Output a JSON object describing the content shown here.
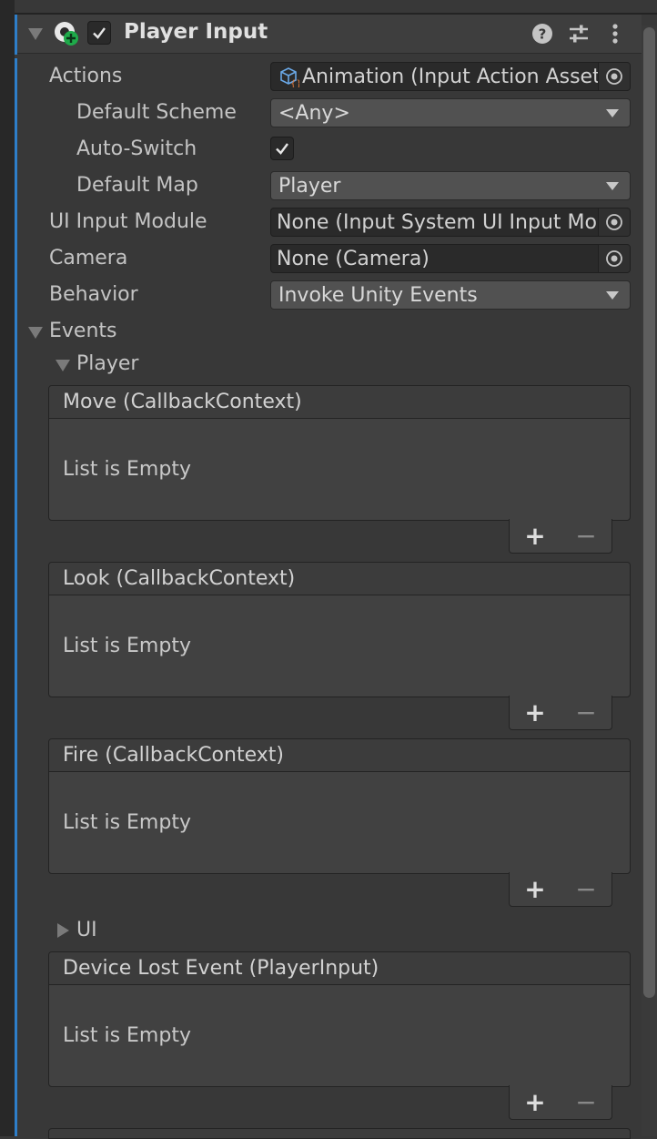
{
  "component": {
    "title": "Player Input",
    "enabled": true,
    "icons": [
      "help-icon",
      "preset-icon",
      "kebab-menu-icon"
    ]
  },
  "fields": {
    "actions": {
      "label": "Actions",
      "value": "Animation (Input Action Asset"
    },
    "default_scheme": {
      "label": "Default Scheme",
      "value": "<Any>"
    },
    "auto_switch": {
      "label": "Auto-Switch",
      "checked": true
    },
    "default_map": {
      "label": "Default Map",
      "value": "Player"
    },
    "ui_input_module": {
      "label": "UI Input Module",
      "value": "None (Input System UI Input Mo"
    },
    "camera": {
      "label": "Camera",
      "value": "None (Camera)"
    },
    "behavior": {
      "label": "Behavior",
      "value": "Invoke Unity Events"
    }
  },
  "events": {
    "label": "Events",
    "player_group": "Player",
    "ui_group": "UI",
    "lists": [
      {
        "title": "Move (CallbackContext)",
        "empty": "List is Empty"
      },
      {
        "title": "Look (CallbackContext)",
        "empty": "List is Empty"
      },
      {
        "title": "Fire (CallbackContext)",
        "empty": "List is Empty"
      },
      {
        "title": "Device Lost Event (PlayerInput)",
        "empty": "List is Empty"
      }
    ],
    "add_label": "+",
    "remove_label": "−"
  },
  "colors": {
    "background": "#383838",
    "accent": "#2e7ec8",
    "field_bg": "#2a2a2a",
    "dropdown_bg": "#515151"
  }
}
